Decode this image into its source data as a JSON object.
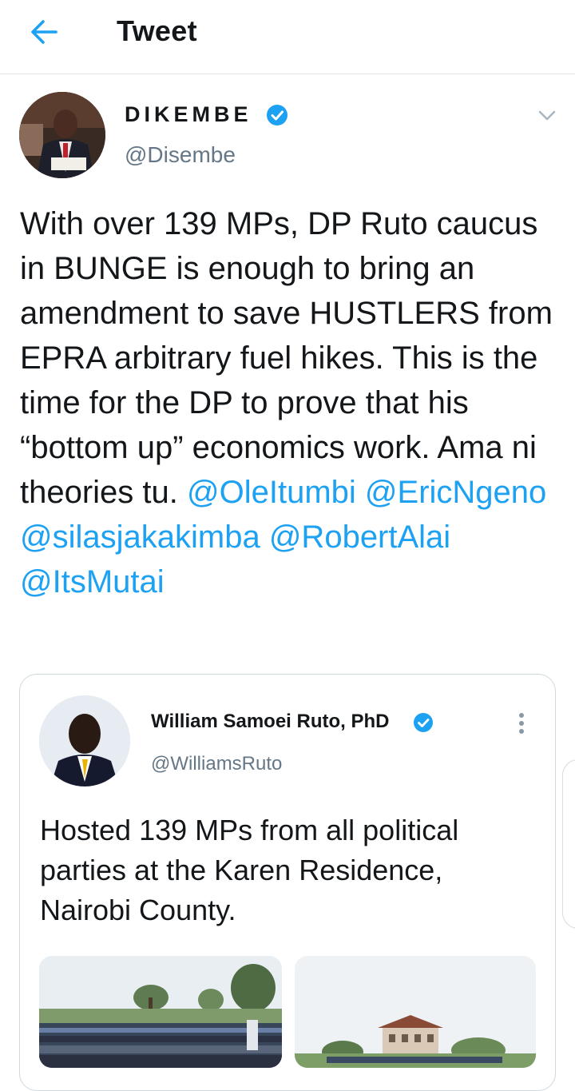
{
  "header": {
    "title": "Tweet",
    "back_icon": "arrow-left-icon"
  },
  "tweet": {
    "author": {
      "display_name": "DIKEMBE",
      "handle": "@Disembe",
      "verified": true
    },
    "text_segments": [
      {
        "text": "With over 139 MPs, DP Ruto caucus in BUNGE is enough to bring an amendment to save HUSTLERS from EPRA arbitrary fuel hikes. This is the time for the DP to prove that his “bottom up” economics work. Ama ni theories tu. ",
        "type": "text"
      },
      {
        "text": "@OleItumbi",
        "type": "mention"
      },
      {
        "text": " ",
        "type": "text"
      },
      {
        "text": "@EricNgeno",
        "type": "mention"
      },
      {
        "text": " ",
        "type": "text"
      },
      {
        "text": "@silasjakakimba",
        "type": "mention"
      },
      {
        "text": " ",
        "type": "text"
      },
      {
        "text": "@RobertAlai",
        "type": "mention"
      },
      {
        "text": " ",
        "type": "text"
      },
      {
        "text": "@ItsMutai",
        "type": "mention"
      }
    ]
  },
  "quoted_tweet": {
    "author": {
      "display_name": "William Samoei Ruto, PhD",
      "handle": "@WilliamsRuto",
      "verified": true
    },
    "text": "Hosted 139 MPs from all political parties at the Karen Residence, Nairobi County.",
    "photos": [
      {
        "alt": "group photo of MPs on lawn"
      },
      {
        "alt": "Karen Residence building"
      }
    ]
  },
  "colors": {
    "accent": "#1da1f2",
    "text": "#14171a",
    "secondary": "#657786",
    "border": "#e1e8ed"
  }
}
